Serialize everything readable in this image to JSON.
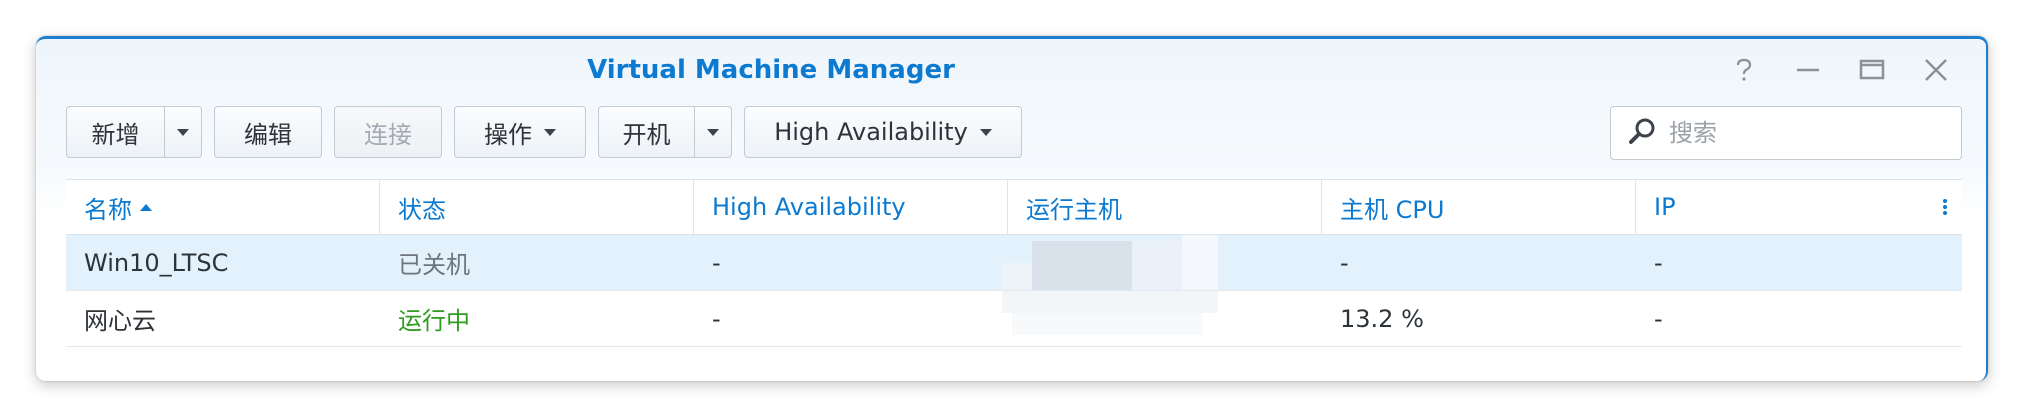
{
  "window": {
    "title": "Virtual Machine Manager",
    "controls": [
      "help-icon",
      "minimize-icon",
      "maximize-icon",
      "close-icon"
    ]
  },
  "toolbar": {
    "create_label": "新增",
    "edit_label": "编辑",
    "connect_label": "连接",
    "action_label": "操作",
    "power_on_label": "开机",
    "ha_label": "High Availability"
  },
  "search": {
    "placeholder": "搜索",
    "value": ""
  },
  "table": {
    "columns": [
      {
        "label": "名称",
        "sorted": "ascending"
      },
      {
        "label": "状态"
      },
      {
        "label": "High Availability"
      },
      {
        "label": "运行主机"
      },
      {
        "label": "主机 CPU"
      },
      {
        "label": "IP"
      }
    ],
    "rows": [
      {
        "name": "Win10_LTSC",
        "status": "已关机",
        "ha": "-",
        "host": "",
        "cpu": "-",
        "ip": "-",
        "selected": true
      },
      {
        "name": "网心云",
        "status": "运行中",
        "ha": "-",
        "host": "",
        "cpu": "13.2 %",
        "ip": "-",
        "selected": false
      }
    ]
  },
  "colors": {
    "accent": "#0b7ad0",
    "selected_row": "#e3f1fc",
    "running": "#2e9c1e",
    "stopped": "#6e757c"
  }
}
